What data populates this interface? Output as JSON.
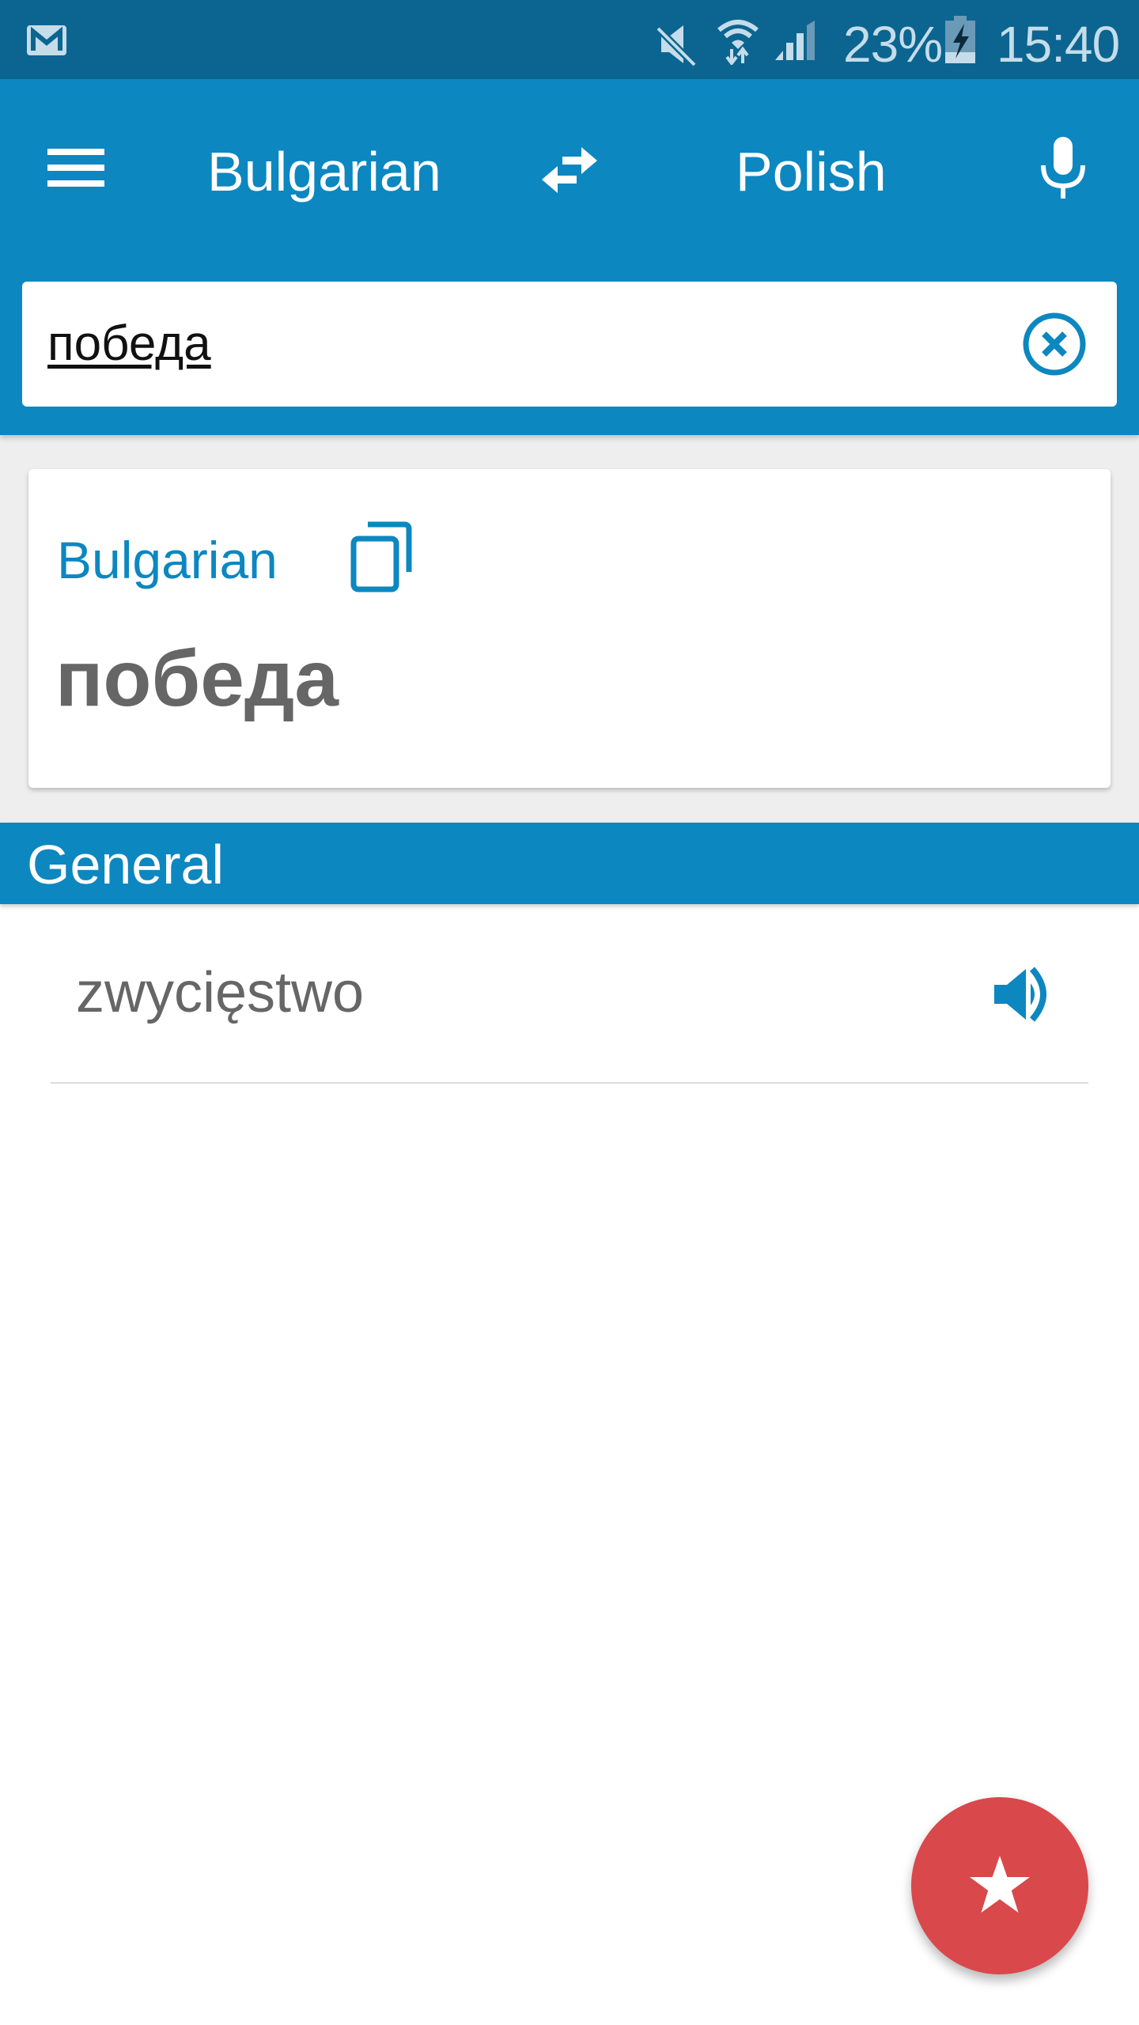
{
  "status_bar": {
    "notification_icon": "gmail-icon",
    "icons": [
      "mute-icon",
      "wifi-icon",
      "signal-icon"
    ],
    "battery_percent": "23%",
    "battery_state": "charging",
    "time": "15:40"
  },
  "app_bar": {
    "menu_icon": "hamburger-menu-icon",
    "source_language": "Bulgarian",
    "swap_icon": "swap-languages-icon",
    "target_language": "Polish",
    "voice_icon": "microphone-icon"
  },
  "search": {
    "value": "победа",
    "clear_icon": "clear-circle-icon"
  },
  "source_card": {
    "language": "Bulgarian",
    "copy_icon": "copy-icon",
    "word": "победа"
  },
  "results": {
    "section_title": "General",
    "items": [
      {
        "translation": "zwycięstwo",
        "audio_icon": "speaker-icon"
      }
    ]
  },
  "fab": {
    "icon": "star-icon",
    "action": "favorite"
  },
  "colors": {
    "status_bar": "#0b6590",
    "primary": "#0c87c0",
    "content_background": "#eeeeee",
    "text_gray": "#666666",
    "fab": "#d9484b"
  }
}
